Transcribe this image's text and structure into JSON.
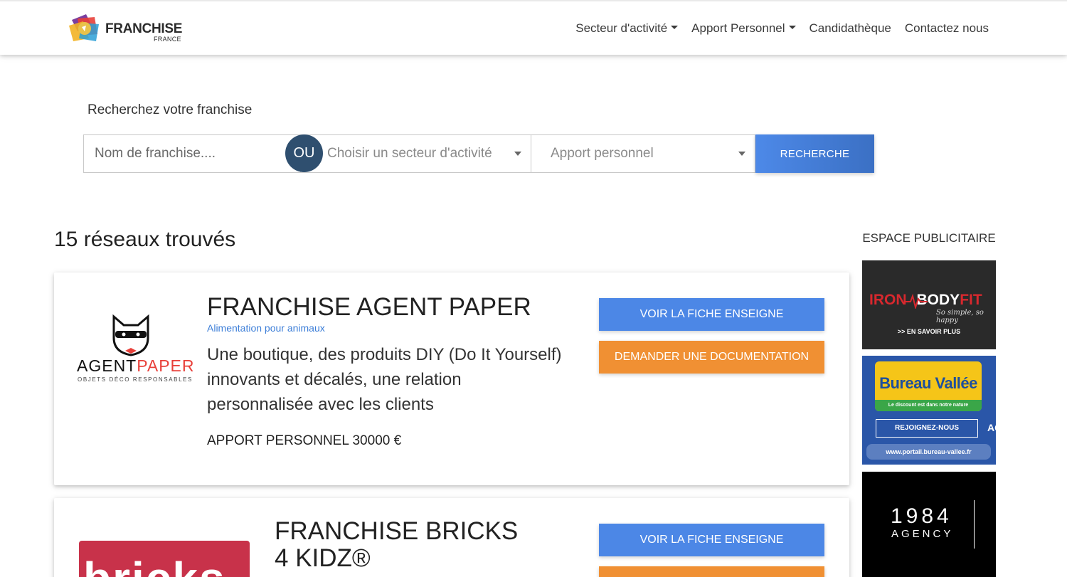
{
  "brand": {
    "name": "FRANCHISE",
    "sub": "FRANCE"
  },
  "nav": {
    "items": [
      {
        "label": "Secteur d'activité",
        "dropdown": true
      },
      {
        "label": "Apport Personnel",
        "dropdown": true
      },
      {
        "label": "Candidathèque",
        "dropdown": false
      },
      {
        "label": "Contactez nous",
        "dropdown": false
      }
    ]
  },
  "search": {
    "label": "Recherchez votre franchise",
    "name_placeholder": "Nom de franchise....",
    "or_label": "OU",
    "sector_placeholder": "Choisir un secteur d'activité",
    "apport_placeholder": "Apport personnel",
    "button_label": "RECHERCHE"
  },
  "results": {
    "count_label": "15 réseaux trouvés",
    "items": [
      {
        "logo_text_1": "AGENT",
        "logo_text_2": "PAPER",
        "logo_tagline": "OBJETS DÉCO RESPONSABLES",
        "title": "FRANCHISE AGENT PAPER",
        "category": "Alimentation pour animaux",
        "description": "Une boutique, des produits DIY (Do It Yourself) innovants et décalés, une relation personnalisée avec les clients",
        "apport": "APPORT PERSONNEL 30000 €",
        "btn_fiche": "VOIR LA FICHE ENSEIGNE",
        "btn_doc": "DEMANDER UNE DOCUMENTATION"
      },
      {
        "logo_text": "bricks",
        "title": "FRANCHISE BRICKS 4 KIDZ®",
        "btn_fiche": "VOIR LA FICHE ENSEIGNE"
      }
    ]
  },
  "ads": {
    "title": "ESPACE PUBLICITAIRE",
    "items": [
      {
        "brand_1": "IRON",
        "brand_2": "BODY",
        "brand_3": "FIT",
        "tagline": "So simple, so happy",
        "cta": ">> EN SAVOIR PLUS"
      },
      {
        "brand": "Bureau Vallée",
        "tagline": "Le discount est dans notre nature",
        "cta": "REJOIGNEZ-NOUS",
        "url": "www.portail.bureau-vallee.fr",
        "edge": "AC"
      },
      {
        "line1": "1984",
        "line2": "AGENCY"
      }
    ]
  },
  "colors": {
    "primary": "#4c87e6",
    "accent": "#f09033",
    "badge": "#2f4f6f",
    "link": "#3c7ed8"
  }
}
